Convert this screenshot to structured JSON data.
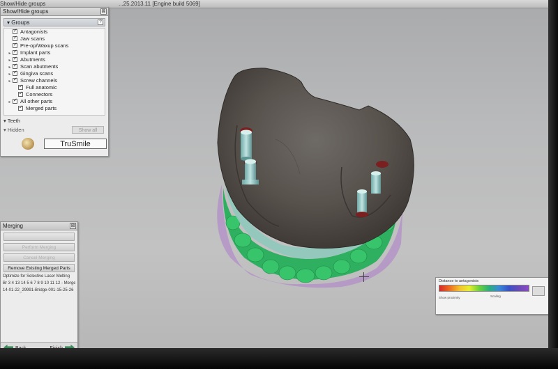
{
  "titlebar": {
    "left": "Show/Hide groups",
    "mid": "...25.2013.11 [Engine build 5069]"
  },
  "show_hide": {
    "title": "Show/Hide groups",
    "close": "⊠",
    "groups_header": "Groups",
    "help": "?",
    "items": [
      {
        "label": "Antagonists",
        "expandable": false,
        "indent": 0
      },
      {
        "label": "Jaw scans",
        "expandable": false,
        "indent": 0
      },
      {
        "label": "Pre-op/Waxup scans",
        "expandable": false,
        "indent": 0
      },
      {
        "label": "Implant parts",
        "expandable": true,
        "indent": 0
      },
      {
        "label": "Abutments",
        "expandable": true,
        "indent": 0
      },
      {
        "label": "Scan abutments",
        "expandable": true,
        "indent": 0
      },
      {
        "label": "Gingiva scans",
        "expandable": true,
        "indent": 0
      },
      {
        "label": "Screw channels",
        "expandable": true,
        "indent": 0
      },
      {
        "label": "Full anatomic",
        "expandable": false,
        "indent": 1
      },
      {
        "label": "Connectors",
        "expandable": false,
        "indent": 1
      },
      {
        "label": "All other parts",
        "expandable": true,
        "indent": 0
      },
      {
        "label": "Merged parts",
        "expandable": false,
        "indent": 1
      }
    ],
    "teeth_label": "Teeth",
    "hidden_label": "Hidden",
    "show_all_label": "Show all",
    "logo_text": "TruSmile"
  },
  "merging": {
    "title": "Merging",
    "close": "⊠",
    "buttons": [
      "",
      "Perform Merging",
      "Cancel Merging"
    ],
    "remove_label": "Remove Existing Merged Parts",
    "text_lines": [
      "Optimize for Selective Laser Melting",
      "Br 3 4 13 14 5 6 7 8 9 10 11 12 - Merge",
      "14-01-22_29991-Bridge-001-15-25-26"
    ],
    "back_label": "Back",
    "finish_label": "Finish"
  },
  "distance_legend": {
    "title": "Distance to antagonists",
    "label_left": "Show proximity",
    "label_mid": "Scaling",
    "colors": [
      "#d62a2a",
      "#ee6a20",
      "#f4c02a",
      "#e7ee2e",
      "#6cd23a",
      "#2ab07a",
      "#3a8ad8",
      "#6a4ab8"
    ]
  }
}
